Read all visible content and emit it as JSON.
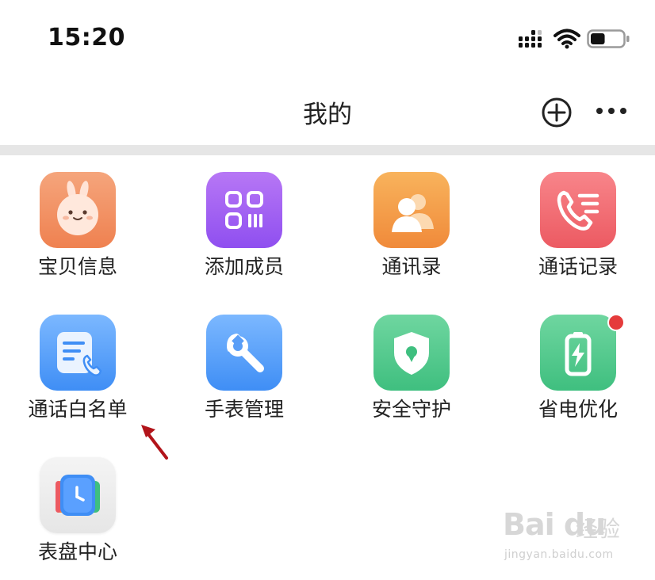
{
  "status_bar": {
    "time": "15:20",
    "signal_icon": "cellular-signal-icon",
    "wifi_icon": "wifi-icon",
    "battery_icon": "battery-icon",
    "battery_level": 0.45
  },
  "nav": {
    "title": "我的",
    "add_icon": "plus-circle-icon",
    "more_icon": "ellipsis-icon"
  },
  "grid": {
    "items": [
      {
        "label": "宝贝信息",
        "icon": "baby-bunny-icon",
        "color_top": "#f5a57c",
        "color_bottom": "#ef8150"
      },
      {
        "label": "添加成员",
        "icon": "qr-code-icon",
        "color_top": "#b777f5",
        "color_bottom": "#8f4ff0"
      },
      {
        "label": "通讯录",
        "icon": "contacts-icon",
        "color_top": "#f8b35c",
        "color_bottom": "#f08a3a"
      },
      {
        "label": "通话记录",
        "icon": "call-log-icon",
        "color_top": "#f8858a",
        "color_bottom": "#ec5a62"
      },
      {
        "label": "通话白名单",
        "icon": "call-whitelist-icon",
        "color_top": "#7cb8ff",
        "color_bottom": "#3f8ef5"
      },
      {
        "label": "手表管理",
        "icon": "wrench-icon",
        "color_top": "#7cb8ff",
        "color_bottom": "#3f8ef5"
      },
      {
        "label": "安全守护",
        "icon": "shield-icon",
        "color_top": "#6fd6a0",
        "color_bottom": "#3fbf7f"
      },
      {
        "label": "省电优化",
        "icon": "battery-bolt-icon",
        "color_top": "#6fd6a0",
        "color_bottom": "#3fbf7f",
        "badge": true
      },
      {
        "label": "表盘中心",
        "icon": "watch-face-icon",
        "color_top": "#f4f4f4",
        "color_bottom": "#e6e6e6"
      }
    ]
  },
  "annotation": {
    "icon": "red-arrow-icon",
    "color": "#b2141a"
  },
  "watermark": {
    "logo": "Bai du",
    "cn": "经验",
    "url": "jingyan.baidu.com"
  }
}
